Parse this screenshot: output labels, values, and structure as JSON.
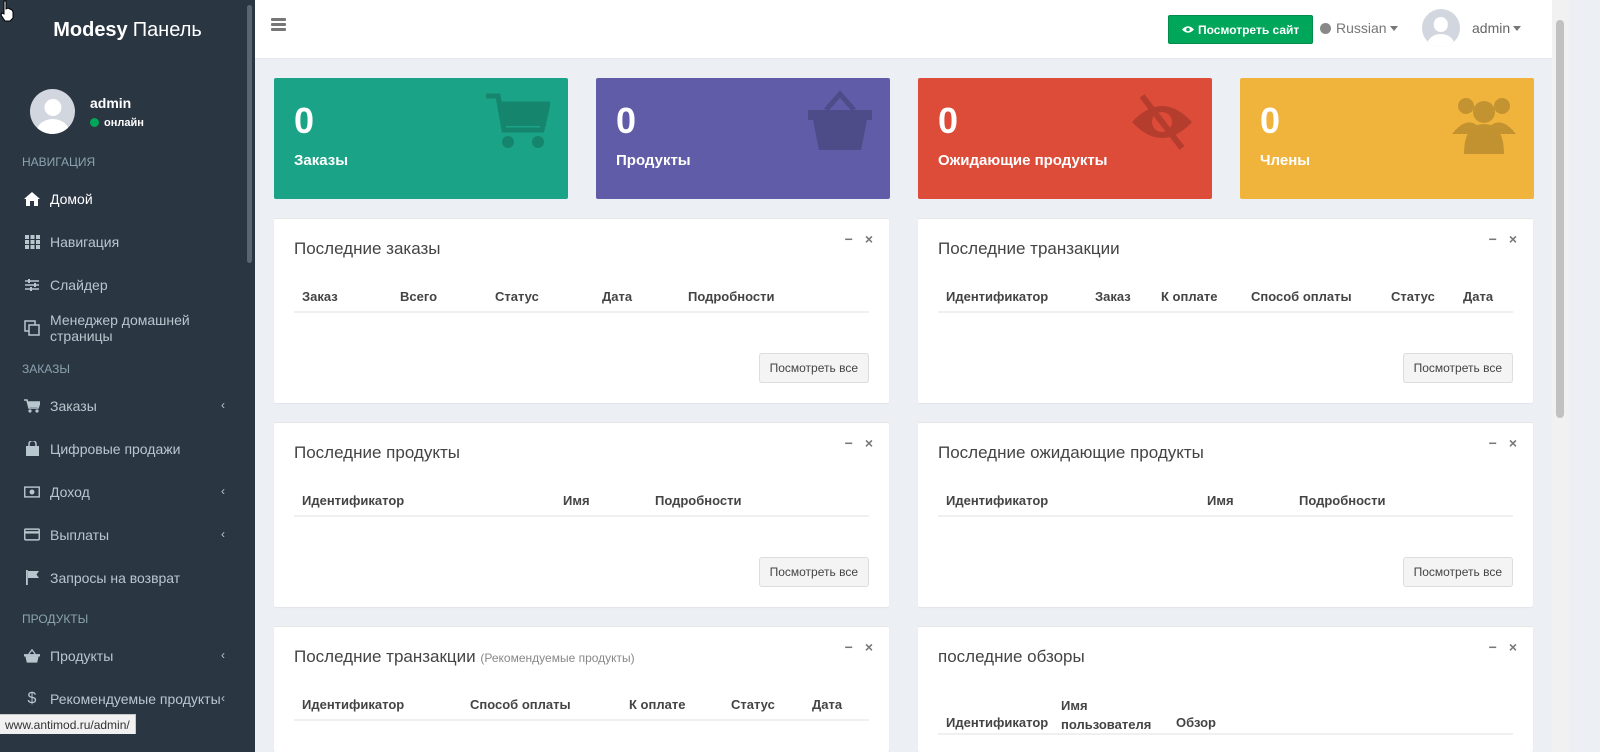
{
  "brand": {
    "bold": "Modesy",
    "light": "Панель"
  },
  "user": {
    "name": "admin",
    "status": "онлайн"
  },
  "sidebar": {
    "sections": {
      "nav": "НАВИГАЦИЯ",
      "orders": "ЗАКАЗЫ",
      "products": "ПРОДУКТЫ"
    },
    "items": [
      {
        "label": "Домой",
        "icon": "home-icon"
      },
      {
        "label": "Навигация",
        "icon": "grid-icon"
      },
      {
        "label": "Слайдер",
        "icon": "sliders-icon"
      },
      {
        "label": "Менеджер домашней страницы",
        "icon": "clone-icon"
      },
      {
        "label": "Заказы",
        "icon": "cart-icon"
      },
      {
        "label": "Цифровые продажи",
        "icon": "shopping-bag-icon"
      },
      {
        "label": "Доход",
        "icon": "money-icon"
      },
      {
        "label": "Выплаты",
        "icon": "credit-card-icon"
      },
      {
        "label": "Запросы на возврат",
        "icon": "flag-icon"
      },
      {
        "label": "Продукты",
        "icon": "basket-icon"
      },
      {
        "label": "Рекомендуемые продукты",
        "icon": "dollar-icon"
      }
    ]
  },
  "header": {
    "view_site": "Посмотреть сайт",
    "language": "Russian",
    "user": "admin"
  },
  "stats": [
    {
      "value": "0",
      "label": "Заказы",
      "color": "#1aa387",
      "icon": "cart-icon"
    },
    {
      "value": "0",
      "label": "Продукты",
      "color": "#605ca8",
      "icon": "basket-icon"
    },
    {
      "value": "0",
      "label": "Ожидающие продукты",
      "color": "#dd4b39",
      "icon": "eye-slash-icon"
    },
    {
      "value": "0",
      "label": "Члены",
      "color": "#f0b43c",
      "icon": "users-icon"
    }
  ],
  "panels": {
    "latest_orders": {
      "title": "Последние заказы",
      "columns": [
        "Заказ",
        "Всего",
        "Статус",
        "Дата",
        "Подробности"
      ],
      "button": "Посмотреть все"
    },
    "latest_transactions": {
      "title": "Последние транзакции",
      "columns": [
        "Идентификатор",
        "Заказ",
        "К оплате",
        "Способ оплаты",
        "Статус",
        "Дата"
      ],
      "button": "Посмотреть все"
    },
    "latest_products": {
      "title": "Последние продукты",
      "columns": [
        "Идентификатор",
        "Имя",
        "Подробности"
      ],
      "button": "Посмотреть все"
    },
    "latest_pending": {
      "title": "Последние ожидающие продукты",
      "columns": [
        "Идентификатор",
        "Имя",
        "Подробности"
      ],
      "button": "Посмотреть все"
    },
    "featured_transactions": {
      "title": "Последние транзакции",
      "subtitle": "(Рекомендуемые продукты)",
      "columns": [
        "Идентификатор",
        "Способ оплаты",
        "К оплате",
        "Статус",
        "Дата"
      ]
    },
    "latest_reviews": {
      "title": "последние обзоры",
      "columns": [
        "Идентификатор",
        "Имя пользователя",
        "Обзор"
      ]
    }
  },
  "status_url": "www.antimod.ru/admin/"
}
